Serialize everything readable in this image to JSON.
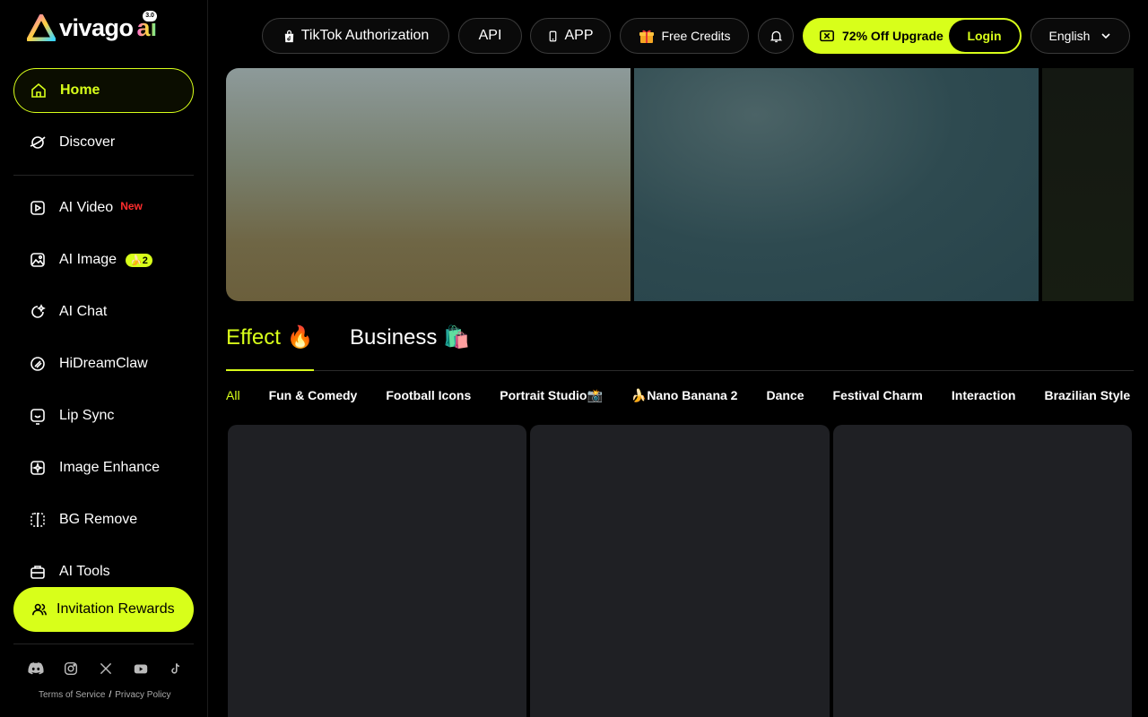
{
  "brand": {
    "name": "vivago",
    "suffix": "ai",
    "version": "3.0"
  },
  "sidebar": {
    "primary": [
      {
        "label": "Home",
        "icon": "home-icon",
        "active": true
      },
      {
        "label": "Discover",
        "icon": "discover-icon",
        "active": false
      }
    ],
    "tools": [
      {
        "label": "AI Video",
        "icon": "video-icon",
        "badge": "New"
      },
      {
        "label": "AI Image",
        "icon": "image-icon",
        "badge": "2"
      },
      {
        "label": "AI Chat",
        "icon": "chat-icon"
      },
      {
        "label": "HiDreamClaw",
        "icon": "claw-icon"
      },
      {
        "label": "Lip Sync",
        "icon": "lip-sync-icon"
      },
      {
        "label": "Image Enhance",
        "icon": "enhance-icon"
      },
      {
        "label": "BG Remove",
        "icon": "bg-remove-icon"
      },
      {
        "label": "AI Tools",
        "icon": "toolbox-icon"
      }
    ],
    "invite": {
      "label": "Invitation Rewards"
    },
    "socials": [
      "discord-icon",
      "instagram-icon",
      "x-icon",
      "youtube-icon",
      "tiktok-icon"
    ],
    "legal": {
      "terms": "Terms of Service",
      "sep": "/",
      "privacy": "Privacy Policy"
    }
  },
  "topbar": {
    "tiktok": "TikTok Authorization",
    "api": "API",
    "app": "APP",
    "credits": "Free Credits",
    "upgrade": "72% Off Upgrade",
    "login": "Login",
    "language": "English"
  },
  "tabs": [
    {
      "label": "Effect 🔥",
      "active": true
    },
    {
      "label": "Business 🛍️",
      "active": false
    }
  ],
  "chips": [
    "All",
    "Fun & Comedy",
    "Football Icons",
    "Portrait Studio📸",
    "🍌Nano Banana 2",
    "Dance",
    "Festival Charm",
    "Interaction",
    "Brazilian Style"
  ],
  "colors": {
    "accent": "#d8ff1a",
    "background": "#000000",
    "card": "#1f2024",
    "new_badge": "#ff2d2d"
  }
}
